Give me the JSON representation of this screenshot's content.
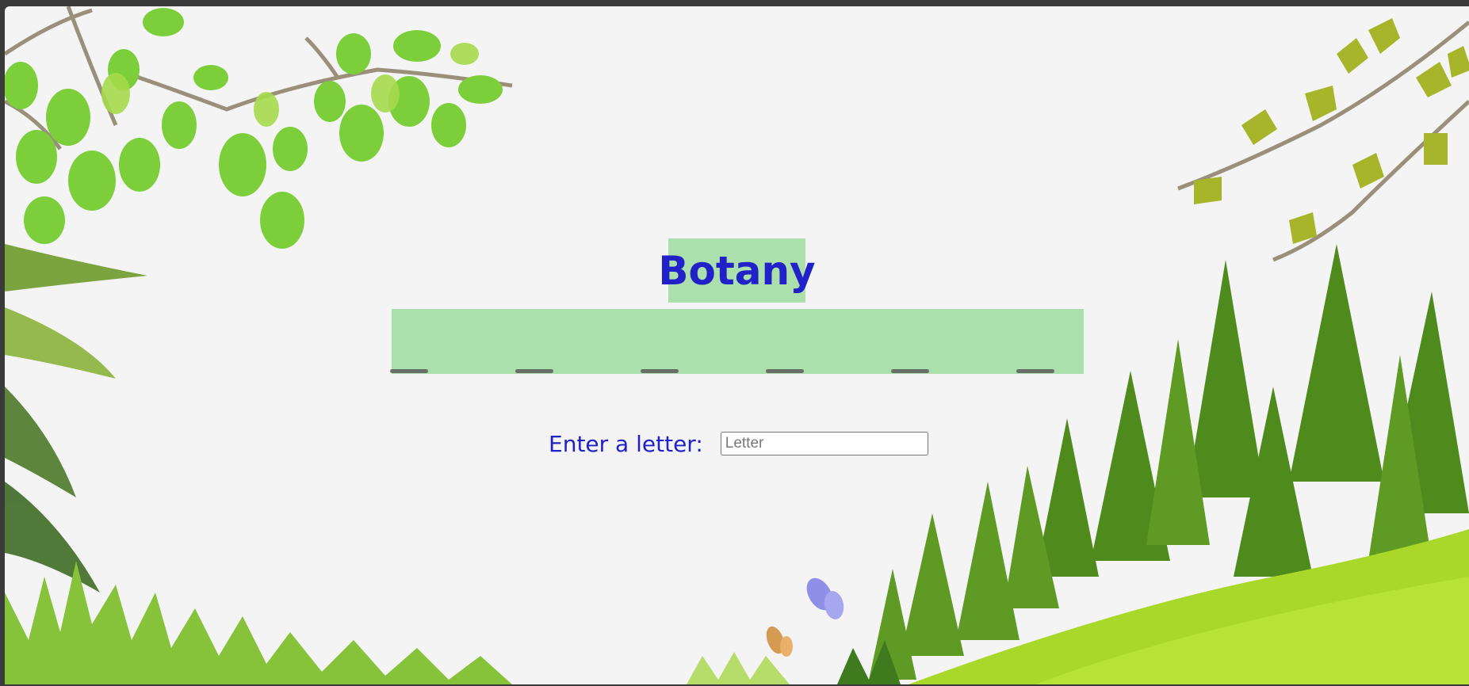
{
  "game": {
    "category_title": "Botany",
    "word_blanks": [
      "",
      "",
      "",
      "",
      "",
      ""
    ],
    "guess_label": "Enter a letter:",
    "letter_input": {
      "placeholder": "Letter",
      "value": ""
    }
  },
  "scenery": {
    "elements": [
      "tree-branch-leaves-icon",
      "holly-branch-icon",
      "pine-forest-icon",
      "green-hill-icon",
      "grass-icon",
      "butterfly-icon"
    ]
  },
  "colors": {
    "accent_text": "#2121c9",
    "panel_bg": "#abdfab",
    "page_bg": "#f4f4f4"
  }
}
